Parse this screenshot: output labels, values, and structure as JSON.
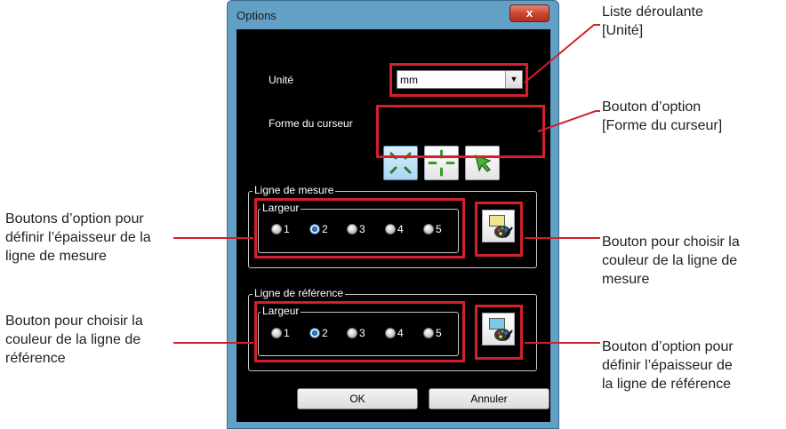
{
  "window": {
    "title": "Options",
    "close_glyph": "x"
  },
  "unit": {
    "label": "Unité",
    "value": "mm",
    "arrow_glyph": "▼"
  },
  "cursor_shape": {
    "label": "Forme du curseur",
    "options": [
      "crosshair-diagonal",
      "crosshair-cross",
      "arrow"
    ],
    "selected_index": 0
  },
  "measure_line": {
    "title": "Ligne de mesure",
    "width_title": "Largeur",
    "options": [
      "1",
      "2",
      "3",
      "4",
      "5"
    ],
    "selected": "2",
    "color": "#f0e68c"
  },
  "reference_line": {
    "title": "Ligne de référence",
    "width_title": "Largeur",
    "options": [
      "1",
      "2",
      "3",
      "4",
      "5"
    ],
    "selected": "2",
    "color": "#7ec8e3"
  },
  "buttons": {
    "ok": "OK",
    "cancel": "Annuler"
  },
  "annotations": {
    "unit_dropdown": [
      "Liste déroulante",
      "[Unité]"
    ],
    "cursor_option": [
      "Bouton d’option",
      "[Forme du curseur]"
    ],
    "measure_width": [
      "Boutons d’option pour",
      "définir l’épaisseur de la",
      "ligne de mesure"
    ],
    "measure_color": [
      "Bouton pour choisir la",
      "couleur de la ligne de",
      "mesure"
    ],
    "reference_color": [
      "Bouton pour choisir la",
      "couleur de la ligne de",
      "référence"
    ],
    "reference_width": [
      "Bouton d’option pour",
      "définir l’épaisseur de",
      "la ligne de référence"
    ]
  },
  "colors": {
    "highlight": "#d3202c",
    "window_frame": "#62a0c6",
    "client_bg": "#000000"
  }
}
